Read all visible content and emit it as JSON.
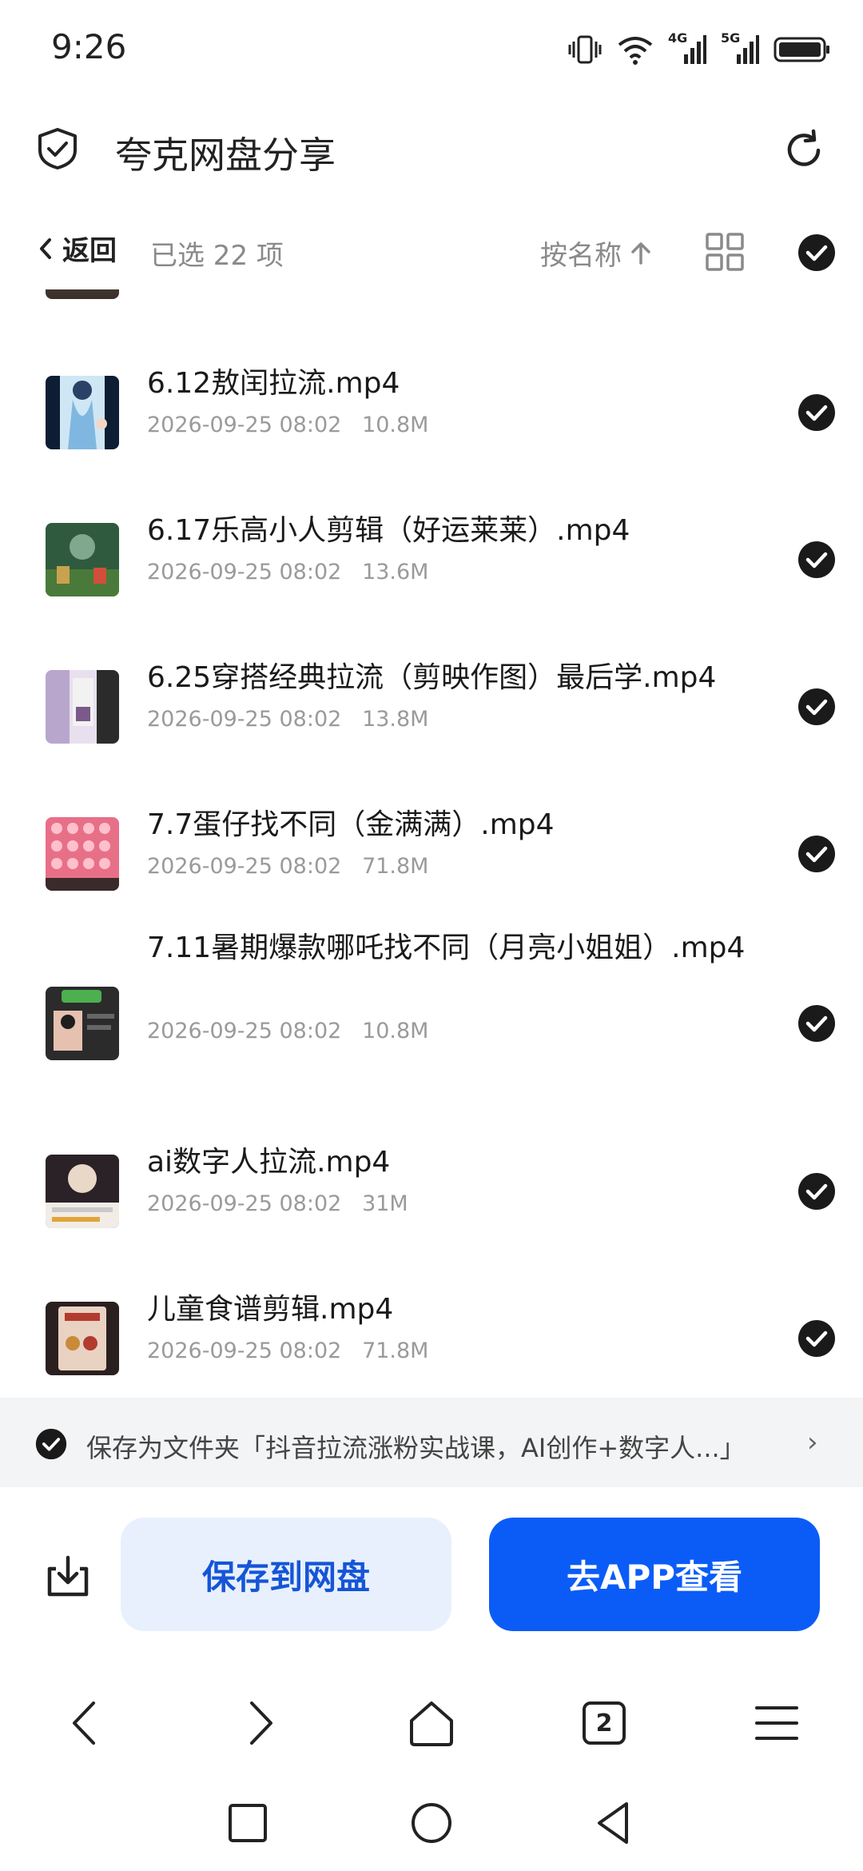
{
  "status_bar": {
    "time": "9:26",
    "net1": "4G",
    "net2": "5G"
  },
  "header": {
    "title": "夸克网盘分享"
  },
  "toolbar": {
    "back_label": "返回",
    "selected_text": "已选 22 项",
    "sort_label": "按名称"
  },
  "files": [
    {
      "name": "6.12敖闰拉流.mp4",
      "date": "2026-09-25 08:02",
      "size": "10.8M",
      "thumb_colors": [
        "#cfe6f5",
        "#7fb7e0"
      ]
    },
    {
      "name": "6.17乐高小人剪辑（好运莱莱）.mp4",
      "date": "2026-09-25 08:02",
      "size": "13.6M",
      "thumb_colors": [
        "#3f6b4a",
        "#c9a24f"
      ]
    },
    {
      "name": "6.25穿搭经典拉流（剪映作图）最后学.mp4",
      "date": "2026-09-25 08:02",
      "size": "13.8M",
      "thumb_colors": [
        "#d9c8e6",
        "#3a3a3a"
      ]
    },
    {
      "name": "7.7蛋仔找不同（金满满）.mp4",
      "date": "2026-09-25 08:02",
      "size": "71.8M",
      "thumb_colors": [
        "#f0a0b0",
        "#e86f88"
      ]
    },
    {
      "name": "7.11暑期爆款哪吒找不同（月亮小姐姐）.mp4",
      "date": "2026-09-25 08:02",
      "size": "10.8M",
      "thumb_colors": [
        "#2b2b2b",
        "#4caf50"
      ]
    },
    {
      "name": "ai数字人拉流.mp4",
      "date": "2026-09-25 08:02",
      "size": "31M",
      "thumb_colors": [
        "#2a2226",
        "#e9d8c8"
      ]
    },
    {
      "name": "儿童食谱剪辑.mp4",
      "date": "2026-09-25 08:02",
      "size": "71.8M",
      "thumb_colors": [
        "#e9d2c2",
        "#b33a2e"
      ]
    }
  ],
  "save_as": {
    "text": "保存为文件夹「抖音拉流涨粉实战课，AI创作+数字人...」"
  },
  "actions": {
    "save_label": "保存到网盘",
    "app_label": "去APP查看"
  },
  "browser_nav": {
    "tab_count": "2"
  },
  "colors": {
    "primary": "#0b5cf7",
    "primary_light": "#e8f0fd",
    "check": "#1a1a1a"
  }
}
